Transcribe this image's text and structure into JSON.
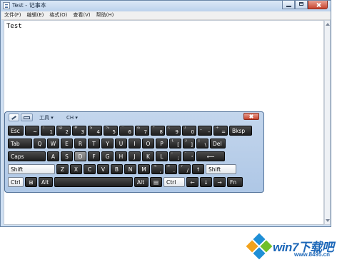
{
  "window": {
    "title": "Test - 记事本",
    "menu": [
      "文件(F)",
      "编辑(E)",
      "格式(O)",
      "查看(V)",
      "帮助(H)"
    ],
    "content": "Test"
  },
  "osk": {
    "tools_label": "工具 ▾",
    "lang_label": "CH ▾",
    "rows": [
      [
        {
          "cap": "Esc"
        },
        {
          "cap": "~",
          "sup": "`"
        },
        {
          "cap": "1",
          "sup": "!"
        },
        {
          "cap": "2",
          "sup": "@"
        },
        {
          "cap": "3",
          "sup": "#"
        },
        {
          "cap": "4",
          "sup": "$"
        },
        {
          "cap": "5",
          "sup": "%"
        },
        {
          "cap": "6",
          "sup": "^"
        },
        {
          "cap": "7",
          "sup": "&"
        },
        {
          "cap": "8",
          "sup": "*"
        },
        {
          "cap": "9",
          "sup": "("
        },
        {
          "cap": "0",
          "sup": ")"
        },
        {
          "cap": "-",
          "sup": "_"
        },
        {
          "cap": "=",
          "sup": "+"
        },
        {
          "cap": "Bksp"
        }
      ],
      [
        {
          "cap": "Tab"
        },
        {
          "cap": "Q"
        },
        {
          "cap": "W"
        },
        {
          "cap": "E"
        },
        {
          "cap": "R"
        },
        {
          "cap": "T"
        },
        {
          "cap": "Y"
        },
        {
          "cap": "U"
        },
        {
          "cap": "I"
        },
        {
          "cap": "O"
        },
        {
          "cap": "P"
        },
        {
          "cap": "[",
          "sup": "{"
        },
        {
          "cap": "]",
          "sup": "}"
        },
        {
          "cap": "\\",
          "sup": "|"
        },
        {
          "cap": "Del"
        }
      ],
      [
        {
          "cap": "Caps"
        },
        {
          "cap": "A"
        },
        {
          "cap": "S"
        },
        {
          "cap": "D"
        },
        {
          "cap": "F"
        },
        {
          "cap": "G"
        },
        {
          "cap": "H"
        },
        {
          "cap": "J"
        },
        {
          "cap": "K"
        },
        {
          "cap": "L"
        },
        {
          "cap": ";",
          "sup": ":"
        },
        {
          "cap": "'",
          "sup": "\""
        },
        {
          "cap": "⟵"
        }
      ],
      [
        {
          "cap": "Shift"
        },
        {
          "cap": "Z"
        },
        {
          "cap": "X"
        },
        {
          "cap": "C"
        },
        {
          "cap": "V"
        },
        {
          "cap": "B"
        },
        {
          "cap": "N"
        },
        {
          "cap": "M"
        },
        {
          "cap": ",",
          "sup": "<"
        },
        {
          "cap": ".",
          "sup": ">"
        },
        {
          "cap": "/",
          "sup": "?"
        },
        {
          "cap": "↑"
        },
        {
          "cap": "Shift"
        }
      ],
      [
        {
          "cap": "Ctrl"
        },
        {
          "cap": "⊞"
        },
        {
          "cap": "Alt"
        },
        {
          "cap": ""
        },
        {
          "cap": "Alt"
        },
        {
          "cap": "▤"
        },
        {
          "cap": "Ctrl"
        },
        {
          "cap": "←"
        },
        {
          "cap": "↓"
        },
        {
          "cap": "→"
        },
        {
          "cap": "Fn"
        }
      ]
    ]
  },
  "logo": {
    "brand": "win7下载吧",
    "url": "www.8495.cn"
  }
}
